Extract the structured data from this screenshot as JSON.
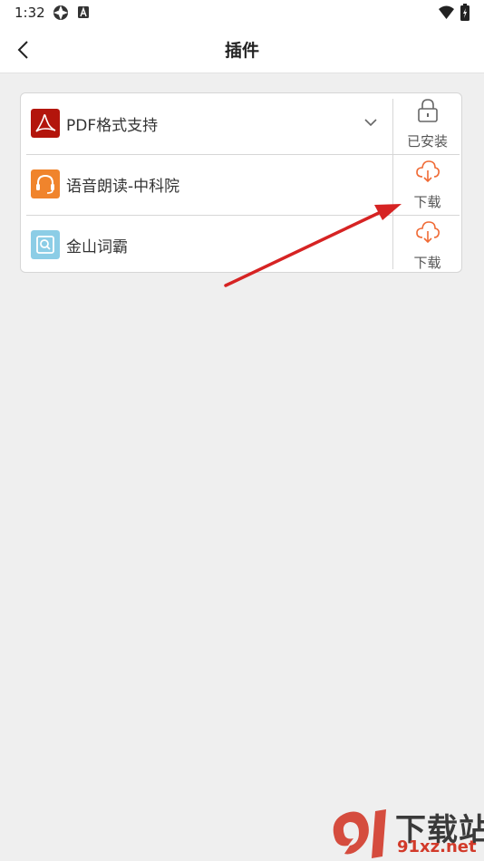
{
  "status_bar": {
    "time": "1:32"
  },
  "app_bar": {
    "title": "插件"
  },
  "plugins": [
    {
      "name": "PDF格式支持",
      "action": "已安装",
      "icon": "pdf-icon",
      "expandable": true
    },
    {
      "name": "语音朗读-中科院",
      "action": "下载",
      "icon": "headset-icon"
    },
    {
      "name": "金山词霸",
      "action": "下载",
      "icon": "dictionary-icon"
    }
  ],
  "watermark": {
    "text_cn": "下载站",
    "text_en": "91xz.net",
    "logo": "9l"
  },
  "colors": {
    "accent": "#f06a35",
    "pdf": "#b3150c",
    "headset": "#f0842c",
    "dictionary": "#8ccde6",
    "annotation_arrow": "#d62323"
  }
}
